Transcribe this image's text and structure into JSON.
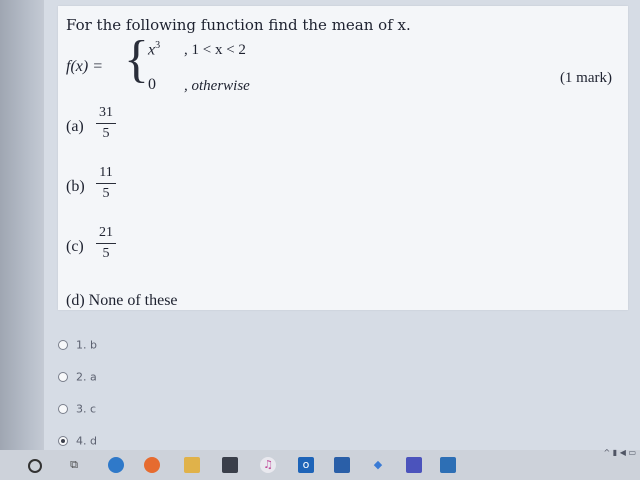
{
  "question": {
    "text": "For the following function find the mean of x.",
    "marks": "(1 mark)",
    "function_label": "f(x) =",
    "cases": [
      {
        "value_base": "x",
        "value_exp": "3",
        "condition": ", 1 < x < 2"
      },
      {
        "value_base": "0",
        "value_exp": "",
        "condition": ", otherwise"
      }
    ]
  },
  "options": [
    {
      "letter": "(a)",
      "numerator": "31",
      "denominator": "5"
    },
    {
      "letter": "(b)",
      "numerator": "11",
      "denominator": "5"
    },
    {
      "letter": "(c)",
      "numerator": "21",
      "denominator": "5"
    }
  ],
  "option_d": "(d) None of these",
  "answers": [
    {
      "label": "1. b",
      "checked": false
    },
    {
      "label": "2. a",
      "checked": false
    },
    {
      "label": "3. c",
      "checked": false
    },
    {
      "label": "4. d",
      "checked": true
    }
  ],
  "taskbar": {
    "icons": [
      "start-icon",
      "task-view-icon",
      "edge-icon",
      "firefox-icon",
      "file-explorer-icon",
      "store-icon",
      "itunes-icon",
      "outlook-icon",
      "mail-icon",
      "dropbox-icon",
      "teams-icon",
      "photos-icon"
    ]
  }
}
